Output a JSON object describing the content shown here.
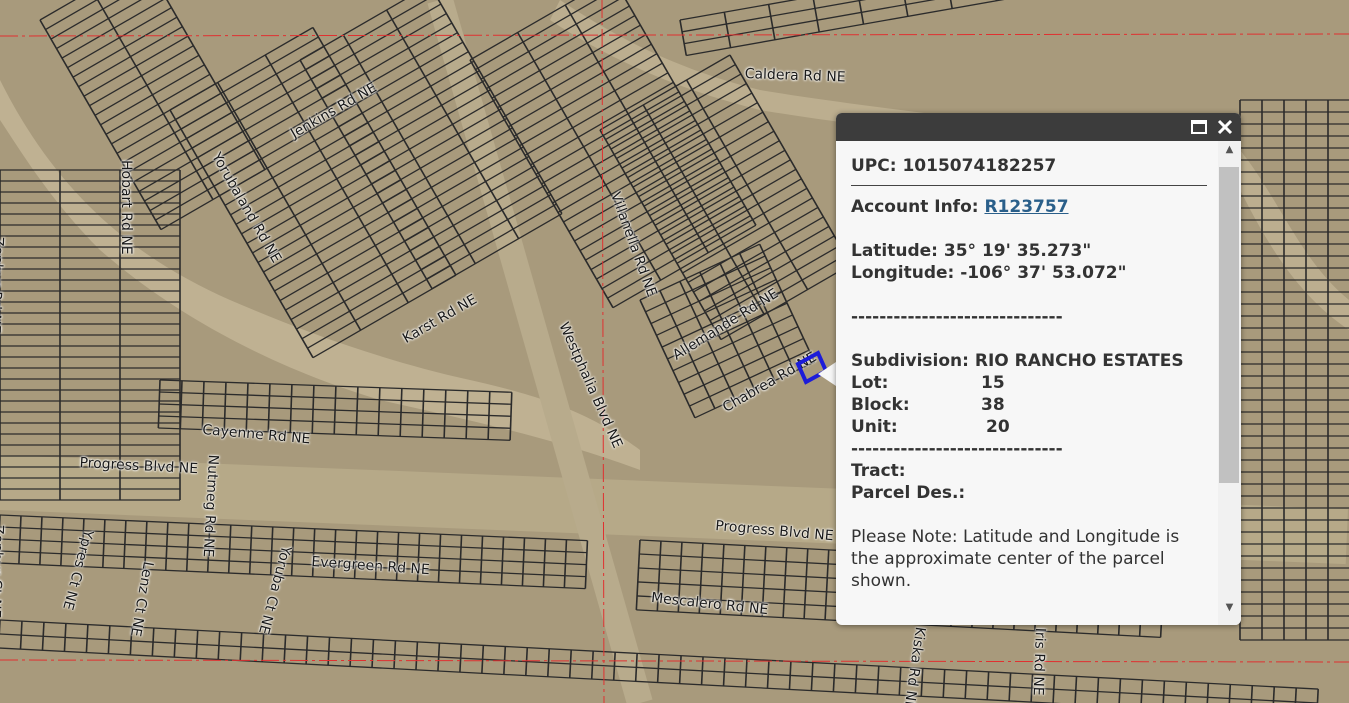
{
  "map": {
    "colors": {
      "terrain": "#a89a7c",
      "parcel_line": "#2b2b2b",
      "boundary_line": "#e03030",
      "highlight": "#1c1cd9"
    },
    "road_labels": [
      "Caldera Rd NE",
      "Jenkins Rd NE",
      "Yorubaland Rd NE",
      "Hobart Rd NE",
      "Zephyr Rd NE",
      "Karst Rd NE",
      "Westphalia Blvd NE",
      "Villanella Rd NE",
      "Allemande Rd NE",
      "Chabrea Rd NE",
      "Cayenne Rd NE",
      "Progress Blvd NE",
      "Progress Blvd NE",
      "Nutmeg Rd NE",
      "Evergreen Rd NE",
      "Ypres Ct NE",
      "Lenz Ct NE",
      "Zephyr Ct NE",
      "Yoruba Ct NE",
      "Mescalero Rd NE",
      "Kiska Rd NE",
      "Iris Rd NE"
    ]
  },
  "popup": {
    "upc_label": "UPC:",
    "upc_value": "1015074182257",
    "account_label": "Account Info:",
    "account_link": "R123757",
    "latitude": "Latitude: 35° 19' 35.273\"",
    "longitude": "Longitude: -106° 37' 53.072\"",
    "dashes": "------------------------------",
    "subdivision": "Subdivision: RIO RANCHO ESTATES",
    "lot_label": "Lot:",
    "lot_value": "15",
    "block_label": "Block:",
    "block_value": "38",
    "unit_label": "Unit:",
    "unit_value": "20",
    "tract_label": "Tract:",
    "parcel_des_label": "Parcel Des.:",
    "note": "Please Note: Latitude and Longitude is the approximate center of the parcel shown.",
    "maximize_icon": "maximize-icon",
    "close_icon": "close-icon"
  }
}
